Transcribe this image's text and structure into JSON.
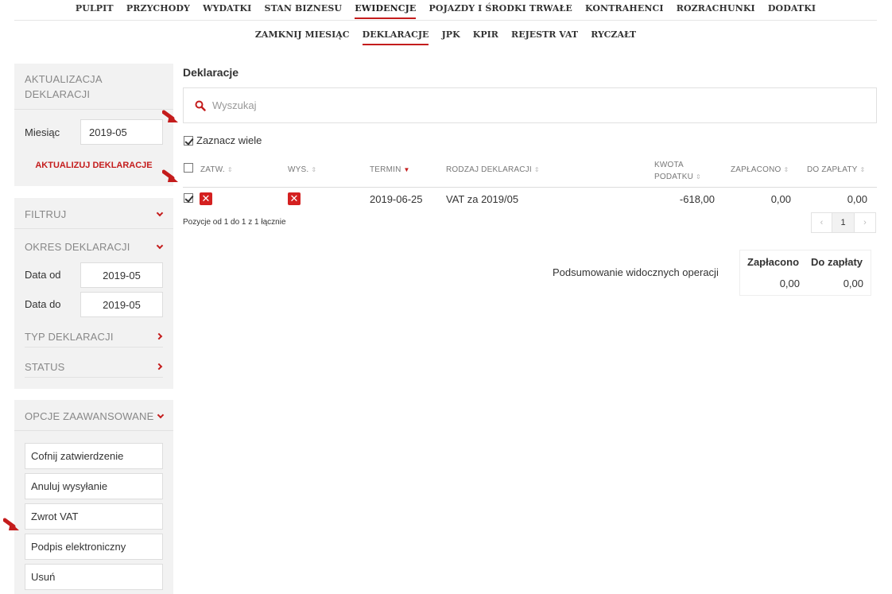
{
  "topnav": [
    "PULPIT",
    "PRZYCHODY",
    "WYDATKI",
    "STAN BIZNESU",
    "EWIDENCJE",
    "POJAZDY I ŚRODKI TRWAŁE",
    "KONTRAHENCI",
    "ROZRACHUNKI",
    "DODATKI"
  ],
  "topnav_active": "EWIDENCJE",
  "subnav": [
    "ZAMKNIJ MIESIĄC",
    "DEKLARACJE",
    "JPK",
    "KPIR",
    "REJESTR VAT",
    "RYCZAŁT"
  ],
  "subnav_active": "DEKLARACJE",
  "sidebar": {
    "update": {
      "title_line1": "AKTUALIZACJA",
      "title_line2": "DEKLARACJI",
      "month_label": "Miesiąc",
      "month_value": "2019-05",
      "button": "AKTUALIZUJ DEKLARACJE"
    },
    "filter": {
      "title": "FILTRUJ",
      "period_title": "OKRES DEKLARACJI",
      "date_from_label": "Data od",
      "date_from_value": "2019-05",
      "date_to_label": "Data do",
      "date_to_value": "2019-05",
      "type_title": "TYP DEKLARACJI",
      "status_title": "STATUS"
    },
    "advanced": {
      "title": "OPCJE ZAAWANSOWANE",
      "buttons": [
        "Cofnij zatwierdzenie",
        "Anuluj wysyłanie",
        "Zwrot VAT",
        "Podpis elektroniczny",
        "Usuń"
      ]
    }
  },
  "main": {
    "title": "Deklaracje",
    "search_placeholder": "Wyszukaj",
    "select_many": "Zaznacz wiele",
    "select_many_checked": true,
    "columns": {
      "zatw": "ZATW.",
      "wys": "WYS.",
      "termin": "TERMIN",
      "rodzaj": "RODZAJ DEKLARACJI",
      "kwota_line1": "KWOTA",
      "kwota_line2": "PODATKU",
      "zaplacono": "ZAPŁACONO",
      "do_zaplaty": "DO ZAPŁATY"
    },
    "rows": [
      {
        "checked": true,
        "termin": "2019-06-25",
        "rodzaj": "VAT za 2019/05",
        "kwota": "-618,00",
        "zaplacono": "0,00",
        "do_zaplaty": "0,00"
      }
    ],
    "pagination_info": "Pozycje od 1 do 1 z 1 łącznie",
    "pagination": {
      "prev": "‹",
      "page": "1",
      "next": "›"
    },
    "summary": {
      "label": "Podsumowanie widocznych operacji",
      "zaplacono_header": "Zapłacono",
      "do_zaplaty_header": "Do zapłaty",
      "zaplacono_value": "0,00",
      "do_zaplaty_value": "0,00"
    }
  },
  "colors": {
    "accent": "#c41c1c",
    "sidebar_bg": "#f2f2f2",
    "x_badge": "#d42020"
  }
}
